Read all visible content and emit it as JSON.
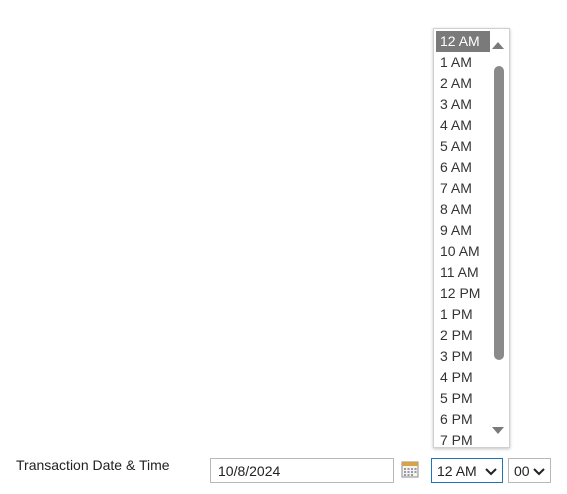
{
  "form": {
    "label": "Transaction Date & Time",
    "date_value": "10/8/2024",
    "hour_value": "12 AM",
    "minute_value": "00"
  },
  "hour_dropdown": {
    "selected": "12 AM",
    "options": [
      "12 AM",
      "1 AM",
      "2 AM",
      "3 AM",
      "4 AM",
      "5 AM",
      "6 AM",
      "7 AM",
      "8 AM",
      "9 AM",
      "10 AM",
      "11 AM",
      "12 PM",
      "1 PM",
      "2 PM",
      "3 PM",
      "4 PM",
      "5 PM",
      "6 PM",
      "7 PM"
    ]
  },
  "icons": {
    "calendar": "calendar-icon",
    "scroll_up": "scroll-up-icon",
    "scroll_down": "scroll-down-icon",
    "chevron": "chevron-down-icon"
  },
  "colors": {
    "focus_border": "#1e73be",
    "selected_bg": "#7a7a7a",
    "scroll_thumb": "#8a8a8a"
  }
}
